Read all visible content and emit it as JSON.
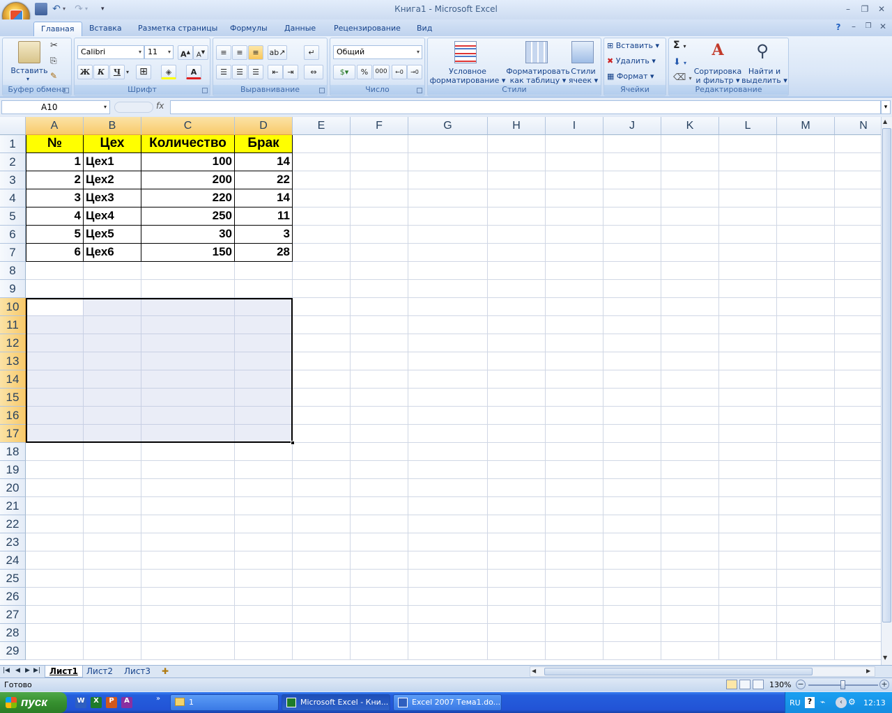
{
  "window": {
    "title": "Книга1 - Microsoft Excel"
  },
  "ribbon_tabs": [
    "Главная",
    "Вставка",
    "Разметка страницы",
    "Формулы",
    "Данные",
    "Рецензирование",
    "Вид"
  ],
  "ribbon": {
    "clipboard": {
      "label": "Буфер обмена",
      "paste": "Вставить"
    },
    "font": {
      "label": "Шрифт",
      "font_name": "Calibri",
      "font_size": "11",
      "bold": "Ж",
      "italic": "К",
      "underline": "Ч"
    },
    "alignment": {
      "label": "Выравнивание"
    },
    "number": {
      "label": "Число",
      "format": "Общий",
      "percent": "%",
      "thousands": "000"
    },
    "styles": {
      "label": "Стили",
      "conditional_1": "Условное",
      "conditional_2": "форматирование",
      "as_table_1": "Форматировать",
      "as_table_2": "как таблицу",
      "cell_styles_1": "Стили",
      "cell_styles_2": "ячеек"
    },
    "cells": {
      "label": "Ячейки",
      "insert": "Вставить",
      "delete": "Удалить",
      "format": "Формат"
    },
    "editing": {
      "label": "Редактирование",
      "sort_1": "Сортировка",
      "sort_2": "и фильтр",
      "find_1": "Найти и",
      "find_2": "выделить",
      "sum": "Σ"
    }
  },
  "formula_bar": {
    "name_box": "A10",
    "fx": "fx",
    "value": ""
  },
  "columns": [
    "A",
    "B",
    "C",
    "D",
    "E",
    "F",
    "G",
    "H",
    "I",
    "J",
    "K",
    "L",
    "M",
    "N"
  ],
  "rows": [
    "1",
    "2",
    "3",
    "4",
    "5",
    "6",
    "7",
    "8",
    "9",
    "10",
    "11",
    "12",
    "13",
    "14",
    "15",
    "16",
    "17",
    "18",
    "19",
    "20",
    "21",
    "22",
    "23",
    "24",
    "25",
    "26",
    "27",
    "28",
    "29"
  ],
  "table": {
    "headers": [
      "№",
      "Цех",
      "Количество",
      "Брак"
    ],
    "rows": [
      [
        "1",
        "Цех1",
        "100",
        "14"
      ],
      [
        "2",
        "Цех2",
        "200",
        "22"
      ],
      [
        "3",
        "Цех3",
        "220",
        "14"
      ],
      [
        "4",
        "Цех4",
        "250",
        "11"
      ],
      [
        "5",
        "Цех5",
        "30",
        "3"
      ],
      [
        "6",
        "Цех6",
        "150",
        "28"
      ]
    ],
    "header_fill": "#ffff00"
  },
  "selection": {
    "range": "A10:D17",
    "active_cell": "A10"
  },
  "sheets": [
    "Лист1",
    "Лист2",
    "Лист3"
  ],
  "status": {
    "text": "Готово",
    "zoom": "130%"
  },
  "taskbar": {
    "start": "пуск",
    "tasks": [
      "1",
      "Microsoft Excel - Кни...",
      "Excel 2007 Тема1.do..."
    ],
    "lang": "RU",
    "clock": "12:13"
  },
  "colors": {
    "accent": "#15428b",
    "selected_header": "#f8c96a",
    "table_header_fill": "#ffff00"
  }
}
